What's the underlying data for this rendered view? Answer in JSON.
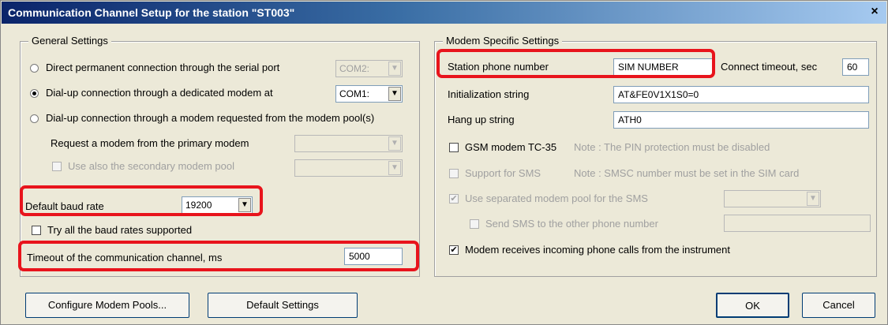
{
  "window": {
    "title": "Communication Channel Setup for the station \"ST003\"",
    "close_glyph": "×",
    "close_icon": "close-icon"
  },
  "general": {
    "title": "General Settings",
    "radio_serial": "Direct permanent connection through the serial port",
    "serial_port": "COM2:",
    "radio_dialup": "Dial-up connection through a dedicated modem at",
    "dialup_port": "COM1:",
    "radio_pool": "Dial-up connection through a modem requested from the modem pool(s)",
    "primary_label": "Request a modem from the primary modem",
    "secondary_label": "Use also the secondary modem pool",
    "baud_label": "Default baud rate",
    "baud_value": "19200",
    "try_all_label": "Try all the baud rates supported",
    "timeout_label": "Timeout of the communication channel, ms",
    "timeout_value": "5000",
    "selected_connection": "dialup"
  },
  "modem": {
    "title": "Modem Specific Settings",
    "phone_label": "Station phone number",
    "phone_value": "SIM NUMBER",
    "connect_timeout_label": "Connect timeout, sec",
    "connect_timeout_value": "60",
    "init_label": "Initialization string",
    "init_value": "AT&FE0V1X1S0=0",
    "hangup_label": "Hang up string",
    "hangup_value": "ATH0",
    "gsm_label": "GSM modem TC-35",
    "gsm_note": "Note : The PIN protection must be disabled",
    "sms_label": "Support for SMS",
    "sms_note": "Note : SMSC number must be set in the SIM card",
    "sep_pool_label": "Use separated modem pool for the SMS",
    "send_sms_label": "Send SMS to the other phone number",
    "incoming_label": "Modem receives incoming phone calls from the instrument",
    "check_glyph": "✔",
    "combo_glyph": "▼"
  },
  "buttons": {
    "pools": "Configure Modem Pools...",
    "defaults": "Default Settings",
    "ok": "OK",
    "cancel": "Cancel"
  },
  "colors": {
    "highlight": "#e8141c",
    "title_start": "#0a246a",
    "title_end": "#a6caf0"
  }
}
